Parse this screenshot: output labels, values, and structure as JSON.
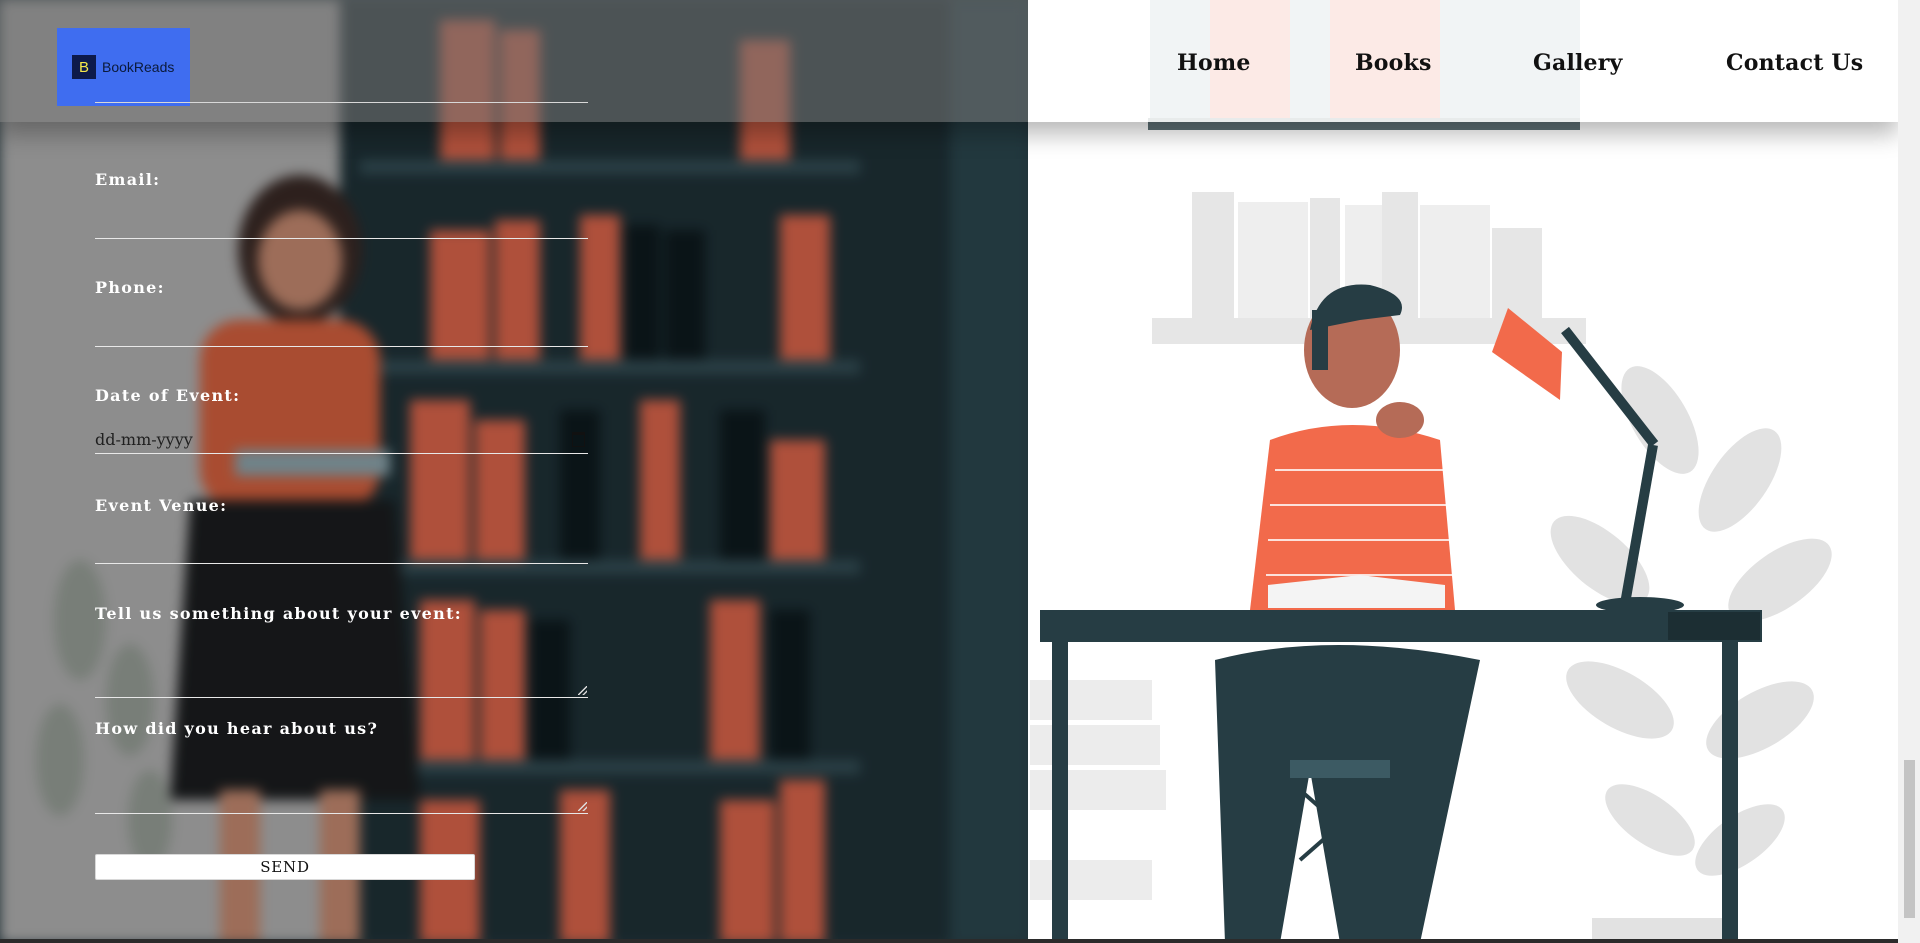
{
  "brand": {
    "logo_letter": "B",
    "name": "BookReads",
    "accent": "#3f6df0"
  },
  "nav": {
    "items": [
      {
        "label": "Home"
      },
      {
        "label": "Books"
      },
      {
        "label": "Gallery"
      },
      {
        "label": "Contact Us"
      }
    ]
  },
  "form": {
    "email": {
      "label": "Email:",
      "value": ""
    },
    "phone": {
      "label": "Phone:",
      "value": ""
    },
    "date": {
      "label": "Date of Event:",
      "placeholder": "dd-mm-yyyy"
    },
    "venue": {
      "label": "Event Venue:",
      "value": ""
    },
    "about_event": {
      "label": "Tell us something about your event:",
      "value": ""
    },
    "referral": {
      "label": "How did you hear about us?",
      "value": ""
    },
    "send_label": "SEND"
  },
  "colors": {
    "illustration_orange": "#f26a4b",
    "illustration_dark": "#263d44",
    "shelf_grey": "#e4e4e4"
  }
}
